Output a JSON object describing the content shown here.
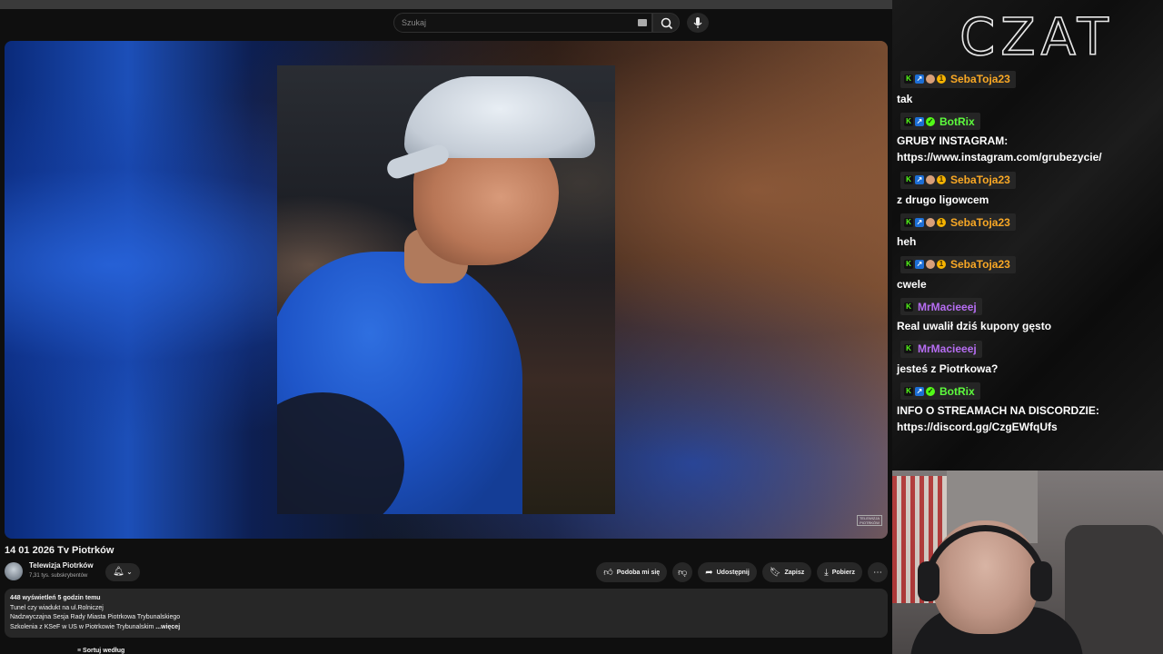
{
  "youtube": {
    "search": {
      "placeholder": "Szukaj"
    },
    "video": {
      "title": "14 01 2026 Tv Piotrków",
      "watermark": "TELEWIZJA PIOTRKÓW"
    },
    "channel": {
      "name": "Telewizja Piotrków",
      "subscribers": "7,31 tys. subskrybentów"
    },
    "actions": {
      "like": "Podoba mi się",
      "share": "Udostępnij",
      "save": "Zapisz",
      "download": "Pobierz"
    },
    "description": {
      "stats": "448 wyświetleń  5 godzin temu",
      "lines": [
        "Tunel czy wiadukt na ul.Rolniczej",
        "Nadzwyczajna Sesja Rady Miasta Piotrkowa Trybunalskiego",
        "Szkolenia z KSeF w US w Piotrkowie Trybunalskim"
      ],
      "more": "...więcej"
    },
    "bottom": {
      "sort_label": "Sortuj według"
    }
  },
  "chat": {
    "header": "CZAT",
    "messages": [
      {
        "user": "SebaToja23",
        "text": "tak",
        "color": "#f9a825",
        "badges": [
          "kick-icon",
          "sub-icon",
          "face-icon",
          "coin-icon"
        ]
      },
      {
        "user": "BotRix",
        "text": "GRUBY INSTAGRAM: https://www.instagram.com/grubezycie/",
        "color": "#5dfc3d",
        "badges": [
          "kick-icon",
          "sub-icon",
          "verified-icon"
        ]
      },
      {
        "user": "SebaToja23",
        "text": "z drugo ligowcem",
        "color": "#f9a825",
        "badges": [
          "kick-icon",
          "sub-icon",
          "face-icon",
          "coin-icon"
        ]
      },
      {
        "user": "SebaToja23",
        "text": "heh",
        "color": "#f9a825",
        "badges": [
          "kick-icon",
          "sub-icon",
          "face-icon",
          "coin-icon"
        ]
      },
      {
        "user": "SebaToja23",
        "text": "cwele",
        "color": "#f9a825",
        "badges": [
          "kick-icon",
          "sub-icon",
          "face-icon",
          "coin-icon"
        ]
      },
      {
        "user": "MrMacieeej",
        "text": "Real uwalił dziś kupony gęsto",
        "color": "#b66df2",
        "badges": [
          "kick-icon"
        ]
      },
      {
        "user": "MrMacieeej",
        "text": "jesteś z Piotrkowa?",
        "color": "#b66df2",
        "badges": [
          "kick-icon"
        ]
      },
      {
        "user": "BotRix",
        "text": "INFO O STREAMACH NA DISCORDZIE: https://discord.gg/CzgEWfqUfs",
        "color": "#5dfc3d",
        "badges": [
          "kick-icon",
          "sub-icon",
          "verified-icon"
        ]
      }
    ]
  }
}
